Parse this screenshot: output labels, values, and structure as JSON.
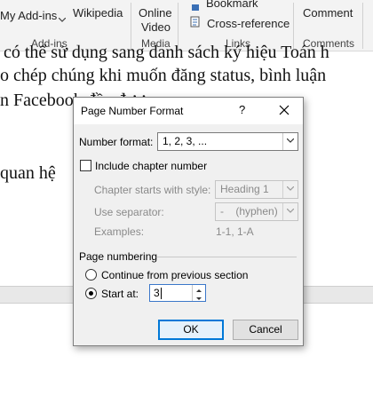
{
  "ribbon": {
    "addins_item": "My Add-ins",
    "wikipedia": "Wikipedia",
    "online_video_line1": "Online",
    "online_video_line2": "Video",
    "bookmark": "Bookmark",
    "cross_reference": "Cross-reference",
    "comment": "Comment",
    "groups": {
      "addins": "Add-ins",
      "media": "Media",
      "links": "Links",
      "comments": "Comments"
    }
  },
  "document": {
    "lines": [
      "có thể sử dụng sang danh sách ký hiệu Toán h",
      "o chép chúng khi muốn đăng status, bình luận",
      "n Facebook đều được.",
      "quan hệ"
    ]
  },
  "dialog": {
    "title": "Page Number Format",
    "help": "?",
    "number_format": {
      "label": "Number format:",
      "value": "1, 2, 3, ..."
    },
    "include_chapter": {
      "label": "Include chapter number",
      "checked": false
    },
    "chapter_style": {
      "label": "Chapter starts with style:",
      "value": "Heading 1"
    },
    "separator": {
      "label": "Use separator:",
      "value": "-    (hyphen)"
    },
    "examples": {
      "label": "Examples:",
      "value": "1-1, 1-A"
    },
    "page_numbering": {
      "heading": "Page numbering",
      "continue_label": "Continue from previous section",
      "start_at_label": "Start at:",
      "start_at_value": "3",
      "selected": "start_at"
    },
    "ok": "OK",
    "cancel": "Cancel"
  },
  "colors": {
    "accent": "#0078d7",
    "dialog_bg": "#f0f0f0",
    "ribbon_bg": "#f3f3f3",
    "disabled_text": "#8a8a8a"
  }
}
